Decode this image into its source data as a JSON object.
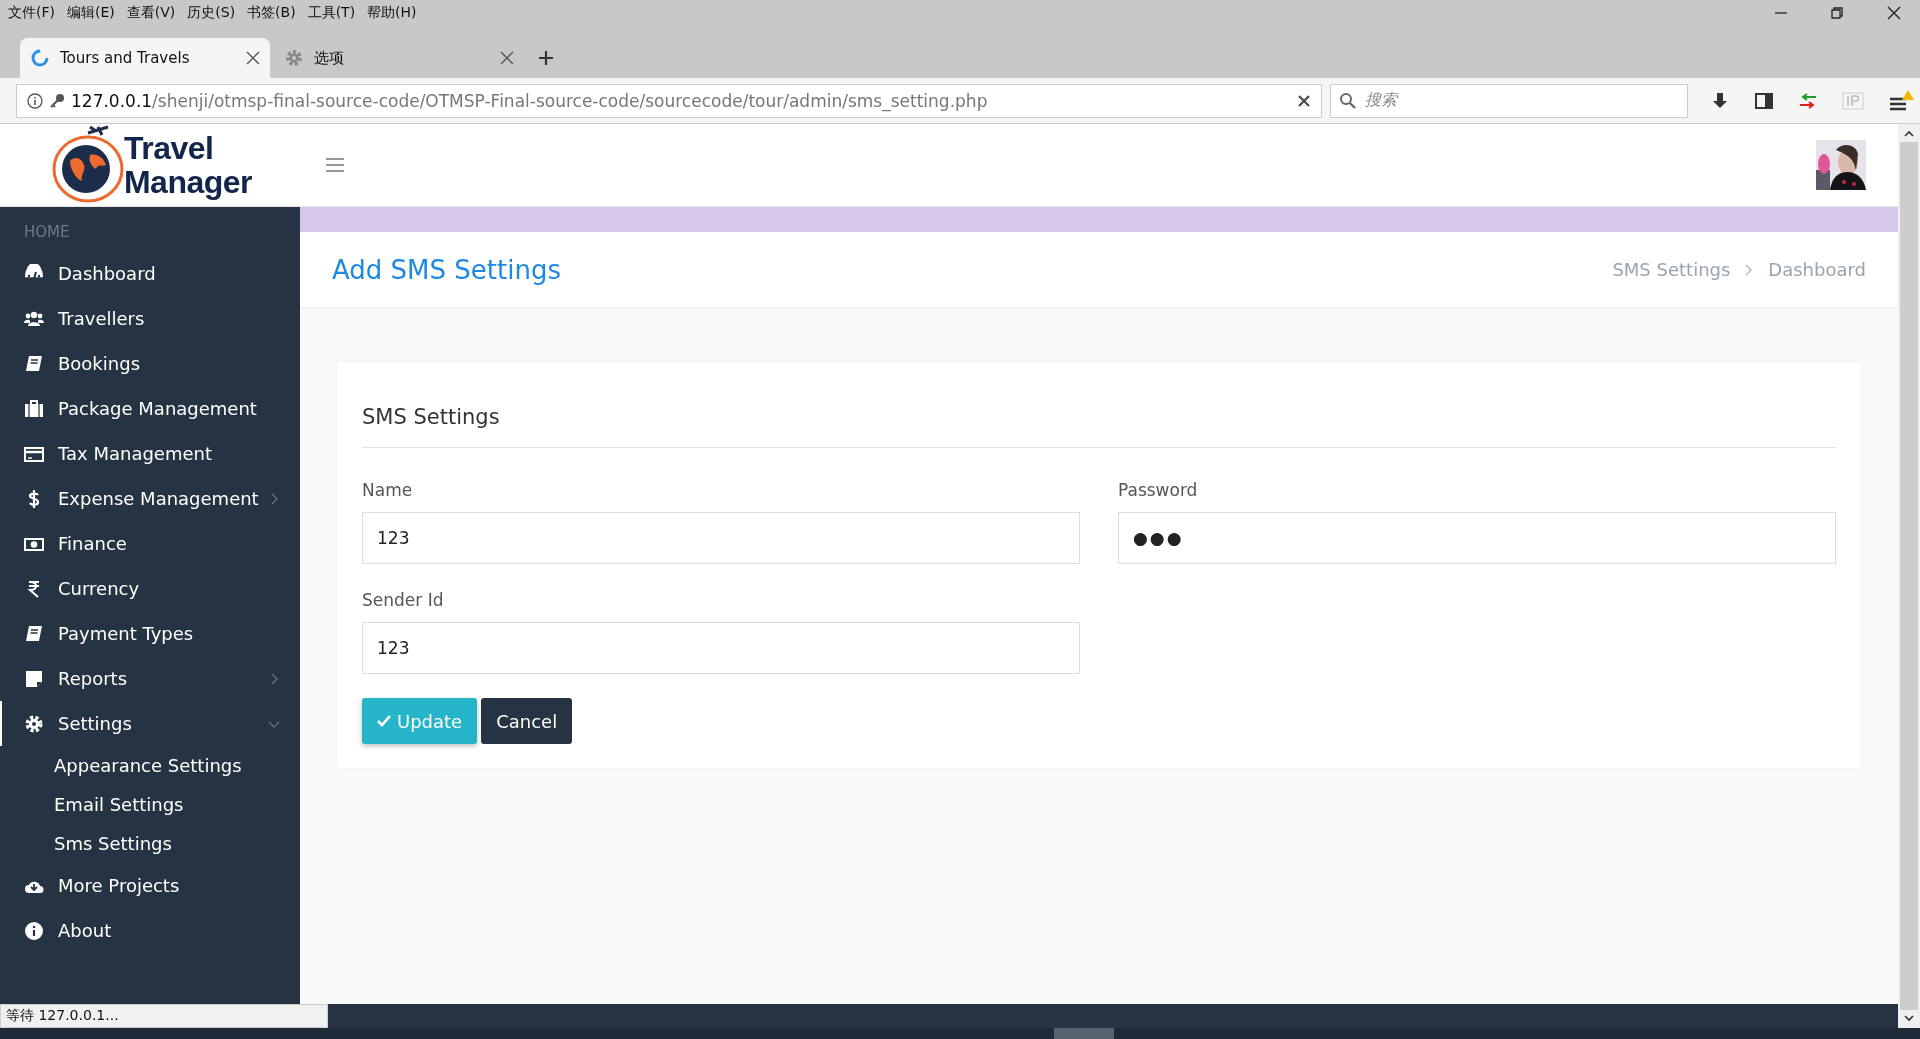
{
  "menu_bar": [
    "文件(F)",
    "编辑(E)",
    "查看(V)",
    "历史(S)",
    "书签(B)",
    "工具(T)",
    "帮助(H)"
  ],
  "tabs": [
    {
      "title": "Tours and Travels",
      "kind": "loading",
      "selected": true
    },
    {
      "title": "选项",
      "kind": "settings",
      "selected": false
    }
  ],
  "address_bar": {
    "host": "127.0.0.1",
    "path": "/shenji/otmsp-final-source-code/OTMSP-Final-source-code/sourcecode/tour/admin/sms_setting.php"
  },
  "search": {
    "placeholder": "搜索"
  },
  "header": {
    "logo_line_1": "Travel",
    "logo_line_2": "Manager"
  },
  "sidebar": {
    "section": "HOME",
    "items": [
      {
        "label": "Dashboard",
        "selected": false
      },
      {
        "label": "Travellers",
        "selected": false
      },
      {
        "label": "Bookings",
        "selected": false
      },
      {
        "label": "Package Management",
        "selected": false
      },
      {
        "label": "Tax Management",
        "selected": false
      },
      {
        "label": "Expense Management",
        "expanded": false,
        "selected": false
      },
      {
        "label": "Finance",
        "selected": false
      },
      {
        "label": "Currency",
        "selected": false
      },
      {
        "label": "Payment Types",
        "selected": false
      },
      {
        "label": "Reports",
        "expanded": false,
        "selected": false
      },
      {
        "label": "Settings",
        "expanded": true,
        "selected": true,
        "children": [
          {
            "label": "Appearance Settings"
          },
          {
            "label": "Email Settings"
          },
          {
            "label": "Sms Settings"
          }
        ]
      },
      {
        "label": "More Projects",
        "selected": false
      },
      {
        "label": "About",
        "selected": false
      }
    ]
  },
  "page": {
    "title": "Add SMS Settings",
    "breadcrumb": [
      "SMS Settings",
      "Dashboard"
    ]
  },
  "card": {
    "title": "SMS Settings",
    "fields": [
      {
        "label": "Name",
        "value": "123",
        "kind": "text"
      },
      {
        "label": "Password",
        "value": "●●●",
        "kind": "password"
      },
      {
        "label": "Sender Id",
        "value": "123",
        "kind": "text"
      }
    ],
    "buttons": [
      {
        "label": "Update",
        "kind": "primary"
      },
      {
        "label": "Cancel",
        "kind": "secondary"
      }
    ]
  },
  "status_bar": "等待 127.0.0.1..."
}
